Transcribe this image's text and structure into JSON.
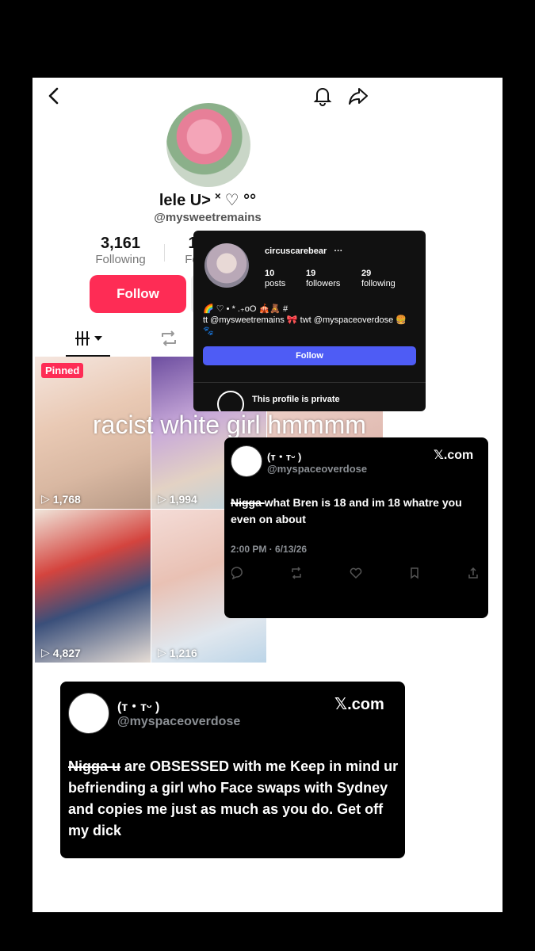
{
  "profile": {
    "display_name": "lele U> ˟ ♡ °°",
    "handle": "@mysweetremains",
    "following_count": "3,161",
    "following_label": "Following",
    "followers_count_partial": "1",
    "followers_label_partial": "Fo",
    "follow_label": "Follow"
  },
  "videos": [
    {
      "views": "1,768",
      "pinned_label": "Pinned"
    },
    {
      "views": "1,994"
    },
    {
      "views": "4,827"
    },
    {
      "views": "1,216"
    }
  ],
  "overlay_caption": "racist white girl hmmmm",
  "instagram_card": {
    "username": "circuscarebear",
    "more": "···",
    "posts_count": "10",
    "posts_label": "posts",
    "followers_count": "19",
    "followers_label": "followers",
    "following_count": "29",
    "following_label": "following",
    "bio_line1": "🌈 ♡ • * .₊oO 🎪🧸 #",
    "bio_line2": "tt @mysweetremains 🎀 twt @myspaceoverdose 🍔",
    "bio_line3": "🐾",
    "follow_label": "Follow",
    "private_label": "This profile is private"
  },
  "tweet1": {
    "name": "(ᴛ・ᴛᵕ )",
    "handle": "@myspaceoverdose",
    "source": "𝕏.com",
    "text_struck": "Nigga ",
    "text_rest": "what Bren is 18 and im 18 whatre you even on about",
    "timestamp": "2:00 PM · 6/13/26"
  },
  "tweet2": {
    "name": "(ᴛ・ᴛᵕ )",
    "handle": "@myspaceoverdose",
    "source": "𝕏.com",
    "text_struck": "Nigga u",
    "text_rest": " are OBSESSED with me Keep in mind ur befriending a girl who Face swaps with Sydney and copies me just as much as you do. Get off my dick"
  },
  "colors": {
    "accent": "#fe2c55",
    "ig_button": "#4e5cf5"
  }
}
